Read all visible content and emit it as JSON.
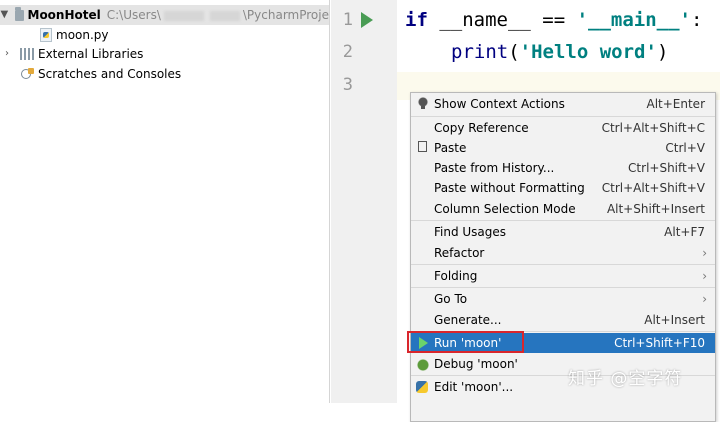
{
  "project_tree": {
    "root_name": "MoonHotel",
    "root_path_start": "C:\\Users\\",
    "root_path_end": "\\PycharmProje",
    "file_name": "moon.py",
    "external_libraries": "External Libraries",
    "scratches": "Scratches and Consoles"
  },
  "gutter": {
    "lines": [
      "1",
      "2",
      "3"
    ]
  },
  "editor": {
    "line1": {
      "kw": "if",
      "name": " __name__ == ",
      "str": "'__main__'",
      "end": ":"
    },
    "line2": {
      "fn": "print",
      "open": "(",
      "str": "'Hello word'",
      "close": ")"
    }
  },
  "context_menu": {
    "items": [
      {
        "label": "Show Context Actions",
        "shortcut": "Alt+Enter"
      },
      {
        "label": "Copy Reference",
        "shortcut": "Ctrl+Alt+Shift+C"
      },
      {
        "label": "Paste",
        "shortcut": "Ctrl+V"
      },
      {
        "label": "Paste from History...",
        "shortcut": "Ctrl+Shift+V"
      },
      {
        "label": "Paste without Formatting",
        "shortcut": "Ctrl+Alt+Shift+V"
      },
      {
        "label": "Column Selection Mode",
        "shortcut": "Alt+Shift+Insert"
      },
      {
        "label": "Find Usages",
        "shortcut": "Alt+F7"
      },
      {
        "label": "Refactor",
        "shortcut": ""
      },
      {
        "label": "Folding",
        "shortcut": ""
      },
      {
        "label": "Go To",
        "shortcut": ""
      },
      {
        "label": "Generate...",
        "shortcut": "Alt+Insert"
      },
      {
        "label": "Run 'moon'",
        "shortcut": "Ctrl+Shift+F10"
      },
      {
        "label": "Debug 'moon'",
        "shortcut": ""
      },
      {
        "label": "Edit 'moon'...",
        "shortcut": ""
      }
    ],
    "submenu_glyph": "›",
    "highlight_color": "#2675bf"
  },
  "watermark": "知乎 @空字符"
}
